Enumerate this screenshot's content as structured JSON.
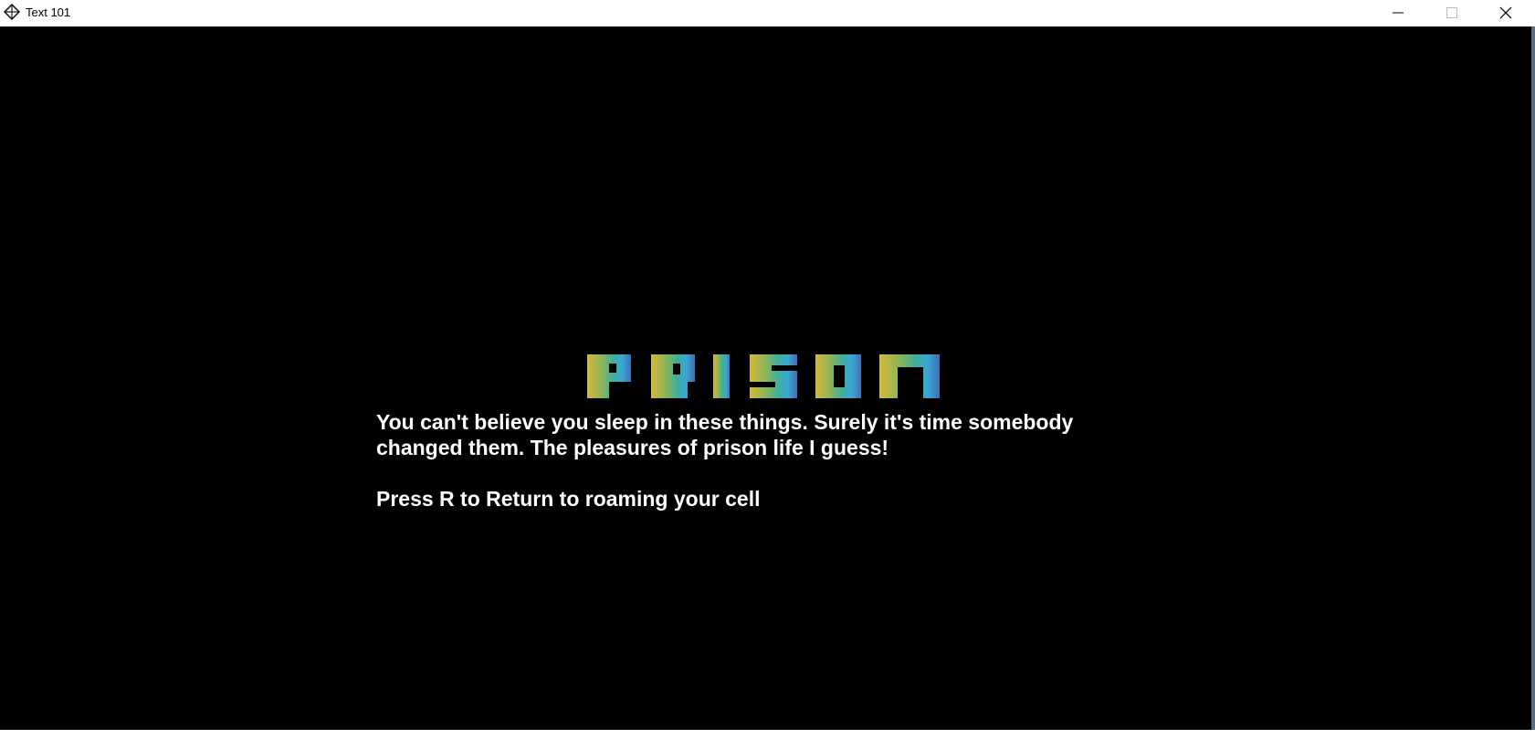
{
  "window": {
    "title": "Text 101",
    "controls": {
      "minimize": "minimize-icon",
      "maximize": "maximize-icon",
      "close": "close-icon"
    }
  },
  "game": {
    "logo_text": "PRISON",
    "story_line_1": "You can't believe you sleep in these things. Surely it's time somebody",
    "story_line_2": "changed them. The pleasures of prison life I guess!",
    "prompt": "Press R to Return to roaming your cell",
    "colors": {
      "background": "#000000",
      "text": "#ffffff",
      "logo_gradient_start": "#c9b53a",
      "logo_gradient_mid": "#4fae8e",
      "logo_gradient_end": "#3f76b8"
    }
  }
}
